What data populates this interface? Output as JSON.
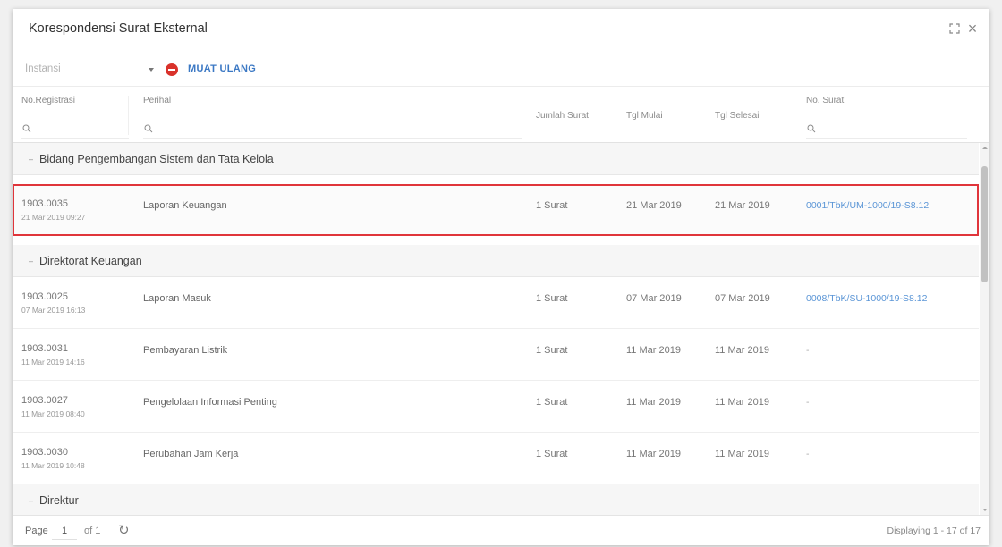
{
  "window": {
    "title": "Korespondensi Surat Eksternal",
    "maximize_icon": "maximize-icon",
    "close_icon": "close-icon",
    "close_glyph": "×"
  },
  "toolbar": {
    "instansi_placeholder": "Instansi",
    "reload_label": "MUAT ULANG"
  },
  "columns": {
    "no_registrasi": "No.Registrasi",
    "perihal": "Perihal",
    "jumlah_surat": "Jumlah Surat",
    "tgl_mulai": "Tgl Mulai",
    "tgl_selesai": "Tgl Selesai",
    "no_surat": "No. Surat"
  },
  "groups": [
    {
      "label": "Bidang Pengembangan Sistem dan Tata Kelola",
      "rows": [
        {
          "reg": "1903.0035",
          "reg_dt": "21 Mar 2019 09:27",
          "perihal": "Laporan Keuangan",
          "jumlah": "1 Surat",
          "mulai": "21 Mar 2019",
          "selesai": "21 Mar 2019",
          "no_surat": "0001/TbK/UM-1000/19-S8.12",
          "selected": true
        }
      ]
    },
    {
      "label": "Direktorat Keuangan",
      "rows": [
        {
          "reg": "1903.0025",
          "reg_dt": "07 Mar 2019 16:13",
          "perihal": "Laporan Masuk",
          "jumlah": "1 Surat",
          "mulai": "07 Mar 2019",
          "selesai": "07 Mar 2019",
          "no_surat": "0008/TbK/SU-1000/19-S8.12"
        },
        {
          "reg": "1903.0031",
          "reg_dt": "11 Mar 2019 14:16",
          "perihal": "Pembayaran Listrik",
          "jumlah": "1 Surat",
          "mulai": "11 Mar 2019",
          "selesai": "11 Mar 2019",
          "no_surat": "-"
        },
        {
          "reg": "1903.0027",
          "reg_dt": "11 Mar 2019 08:40",
          "perihal": "Pengelolaan Informasi Penting",
          "jumlah": "1 Surat",
          "mulai": "11 Mar 2019",
          "selesai": "11 Mar 2019",
          "no_surat": "-"
        },
        {
          "reg": "1903.0030",
          "reg_dt": "11 Mar 2019 10:48",
          "perihal": "Perubahan Jam Kerja",
          "jumlah": "1 Surat",
          "mulai": "11 Mar 2019",
          "selesai": "11 Mar 2019",
          "no_surat": "-"
        }
      ]
    },
    {
      "label": "Direktur",
      "rows": []
    }
  ],
  "footer": {
    "page_label": "Page",
    "page_value": "1",
    "of_label": "of 1",
    "displaying": "Displaying 1 - 17 of 17"
  },
  "colors": {
    "accent": "#3b78c4",
    "link": "#5a95d6",
    "selection_border": "#e0353b",
    "remove_button": "#d9322b"
  }
}
